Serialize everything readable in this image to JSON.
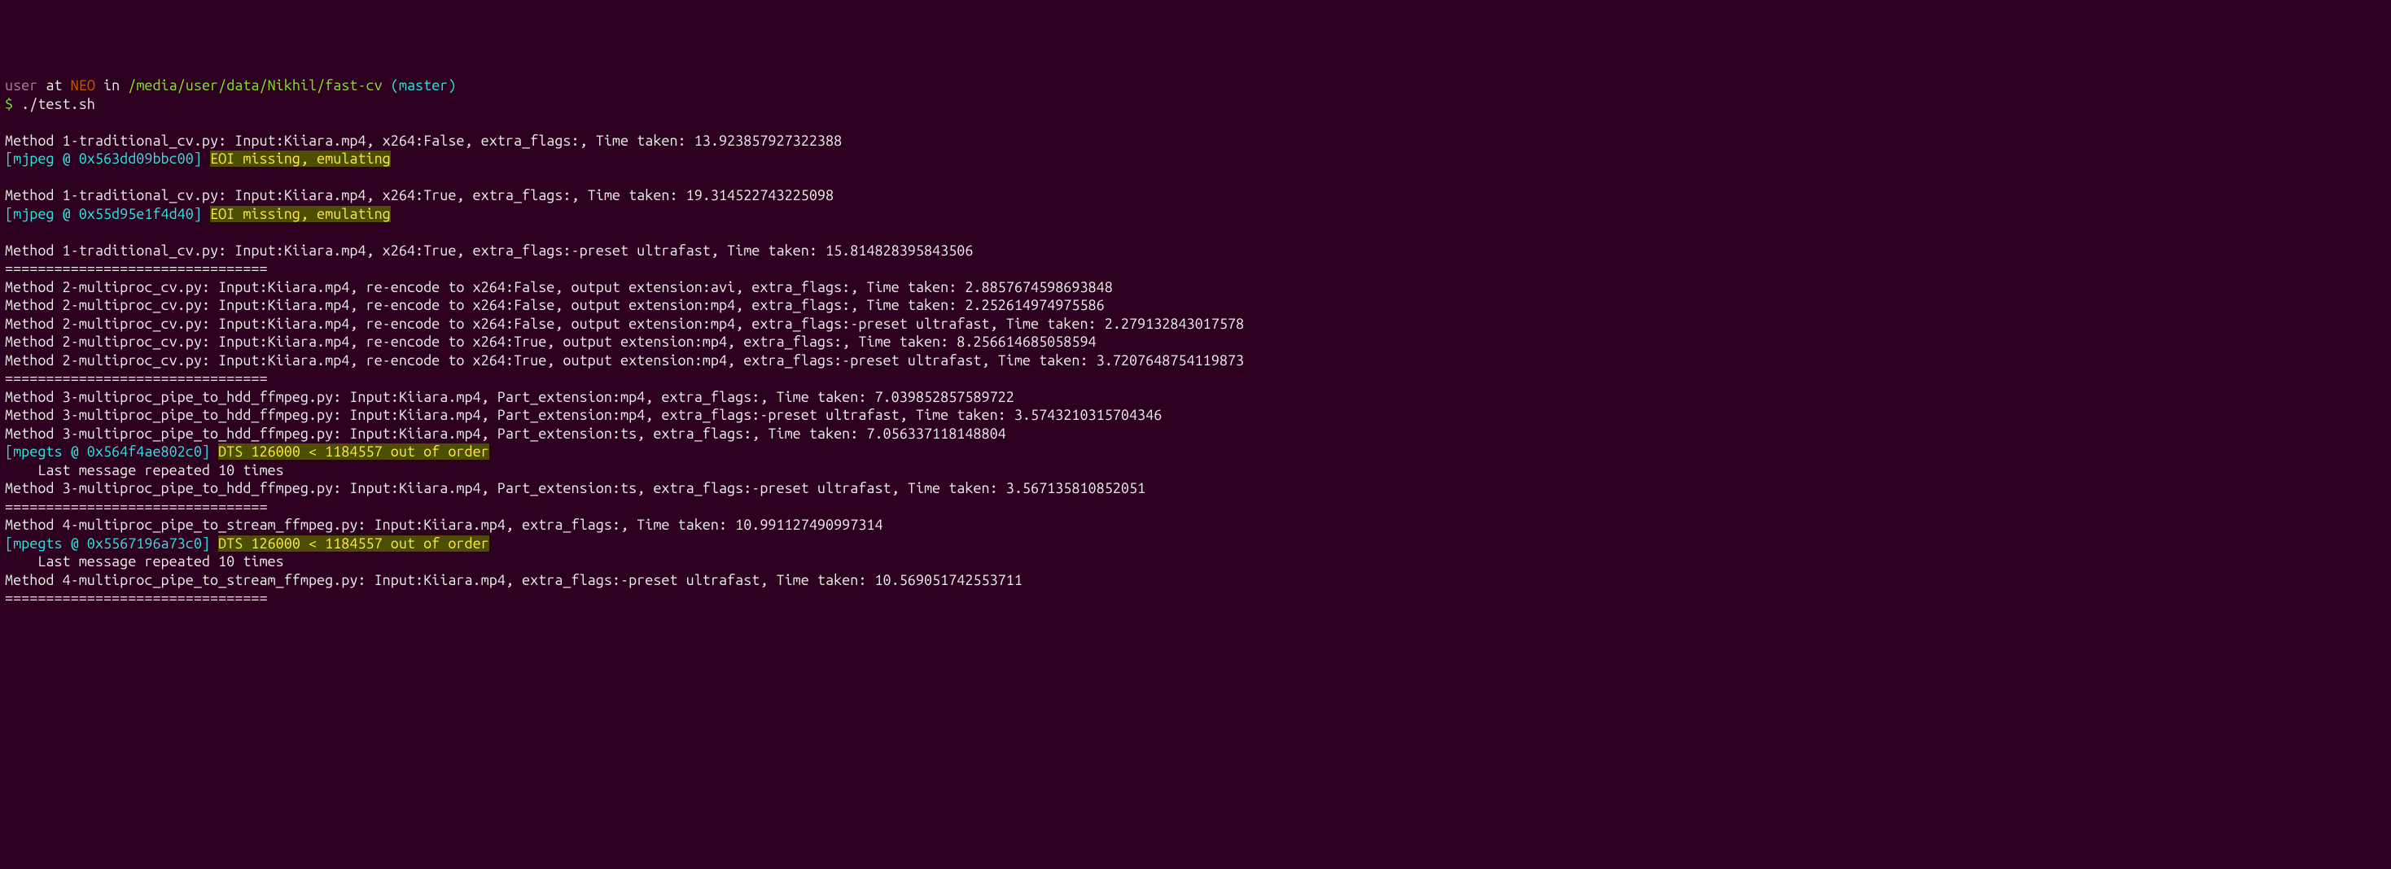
{
  "prompt": {
    "user": "user",
    "at": " at ",
    "host": "NEO",
    "in": " in ",
    "path": "/media/user/data/Nikhil/fast-cv",
    "branch_open": " (",
    "branch": "master",
    "branch_close": ")",
    "dollar": "$ ",
    "command": "./test.sh"
  },
  "lines": {
    "l1": "Method 1-traditional_cv.py: Input:Kiiara.mp4, x264:False, extra_flags:, Time taken: 13.923857927322388",
    "l2_tag": "[mjpeg @ 0x563dd09bbc00] ",
    "l2_msg": "EOI missing, emulating",
    "l3": "Method 1-traditional_cv.py: Input:Kiiara.mp4, x264:True, extra_flags:, Time taken: 19.314522743225098",
    "l4_tag": "[mjpeg @ 0x55d95e1f4d40] ",
    "l4_msg": "EOI missing, emulating",
    "l5": "Method 1-traditional_cv.py: Input:Kiiara.mp4, x264:True, extra_flags:-preset ultrafast, Time taken: 15.814828395843506",
    "sep1": "================================",
    "l6": "Method 2-multiproc_cv.py: Input:Kiiara.mp4, re-encode to x264:False, output extension:avi, extra_flags:, Time taken: 2.8857674598693848",
    "l7": "Method 2-multiproc_cv.py: Input:Kiiara.mp4, re-encode to x264:False, output extension:mp4, extra_flags:, Time taken: 2.252614974975586",
    "l8": "Method 2-multiproc_cv.py: Input:Kiiara.mp4, re-encode to x264:False, output extension:mp4, extra_flags:-preset ultrafast, Time taken: 2.279132843017578",
    "l9": "Method 2-multiproc_cv.py: Input:Kiiara.mp4, re-encode to x264:True, output extension:mp4, extra_flags:, Time taken: 8.256614685058594",
    "l10": "Method 2-multiproc_cv.py: Input:Kiiara.mp4, re-encode to x264:True, output extension:mp4, extra_flags:-preset ultrafast, Time taken: 3.7207648754119873",
    "sep2": "================================",
    "l11": "Method 3-multiproc_pipe_to_hdd_ffmpeg.py: Input:Kiiara.mp4, Part_extension:mp4, extra_flags:, Time taken: 7.039852857589722",
    "l12": "Method 3-multiproc_pipe_to_hdd_ffmpeg.py: Input:Kiiara.mp4, Part_extension:mp4, extra_flags:-preset ultrafast, Time taken: 3.5743210315704346",
    "l13": "Method 3-multiproc_pipe_to_hdd_ffmpeg.py: Input:Kiiara.mp4, Part_extension:ts, extra_flags:, Time taken: 7.056337118148804",
    "l14_tag": "[mpegts @ 0x564f4ae802c0] ",
    "l14_msg": "DTS 126000 < 1184557 out of order",
    "l15": "    Last message repeated 10 times",
    "l16": "Method 3-multiproc_pipe_to_hdd_ffmpeg.py: Input:Kiiara.mp4, Part_extension:ts, extra_flags:-preset ultrafast, Time taken: 3.567135810852051",
    "sep3": "================================",
    "l17": "Method 4-multiproc_pipe_to_stream_ffmpeg.py: Input:Kiiara.mp4, extra_flags:, Time taken: 10.991127490997314",
    "l18_tag": "[mpegts @ 0x5567196a73c0] ",
    "l18_msg": "DTS 126000 < 1184557 out of order",
    "l19": "    Last message repeated 10 times",
    "l20": "Method 4-multiproc_pipe_to_stream_ffmpeg.py: Input:Kiiara.mp4, extra_flags:-preset ultrafast, Time taken: 10.569051742553711",
    "sep4": "================================"
  }
}
